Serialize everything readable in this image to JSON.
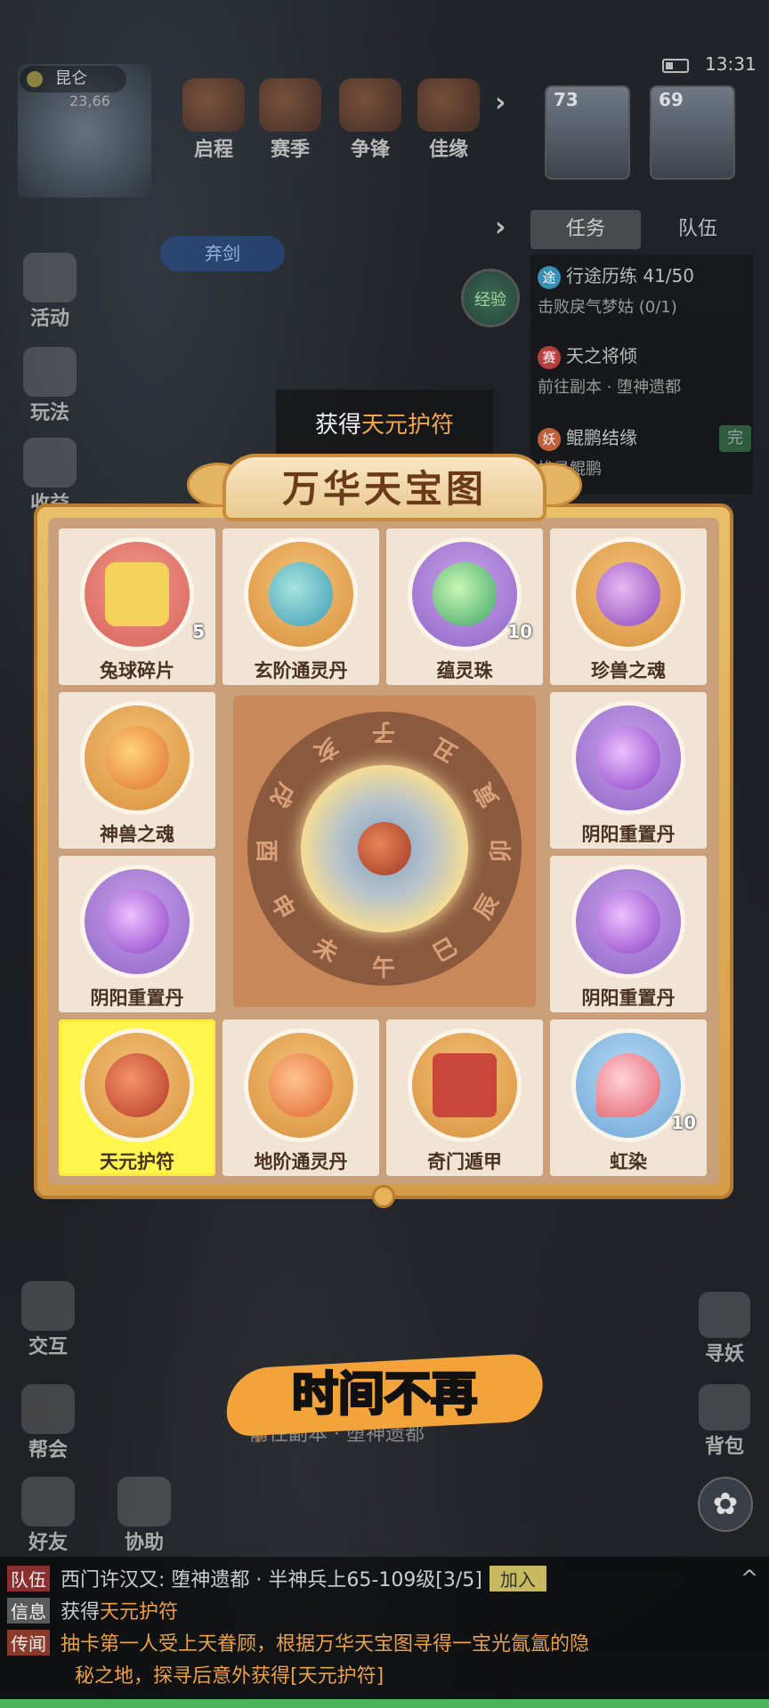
{
  "status_bar": {
    "time": "13:31"
  },
  "minimap": {
    "location": "昆仑",
    "coords": "23,66",
    "marker_label": "弃剑"
  },
  "top_nav": [
    {
      "label": "启程"
    },
    {
      "label": "赛季"
    },
    {
      "label": "争锋"
    },
    {
      "label": "佳缘"
    }
  ],
  "party": [
    {
      "level": "73"
    },
    {
      "level": "69"
    }
  ],
  "panel_tabs": {
    "task": "任务",
    "team": "队伍"
  },
  "exp_button": "经验",
  "tasks": [
    {
      "badge": "途",
      "badge_color": "#3a8fb5",
      "title": "行途历练 41/50",
      "sub": "击败戾气梦姑 (0/1)"
    },
    {
      "badge": "赛",
      "badge_color": "#b54040",
      "title": "天之将倾",
      "sub": "前往副本 · 堕神遗都"
    },
    {
      "badge": "妖",
      "badge_color": "#c0603a",
      "title": "鲲鹏结缘",
      "sub": "找寻鲲鹏",
      "status": "完"
    }
  ],
  "left_menu": [
    {
      "label": "活动"
    },
    {
      "label": "玩法"
    },
    {
      "label": "收益"
    }
  ],
  "toast": {
    "prefix": "获得",
    "item": "天元护符"
  },
  "board": {
    "title": "万华天宝图",
    "center_ring": [
      "子",
      "丑",
      "寅",
      "卯",
      "辰",
      "巳",
      "午",
      "未",
      "申",
      "酉",
      "戌",
      "亥"
    ],
    "cells": [
      {
        "name": "兔球碎片",
        "count": "5",
        "theme": "red"
      },
      {
        "name": "玄阶通灵丹",
        "count": "",
        "theme": "gold"
      },
      {
        "name": "蕴灵珠",
        "count": "10",
        "theme": "purple"
      },
      {
        "name": "珍兽之魂",
        "count": "",
        "theme": "gold"
      },
      {
        "name": "神兽之魂",
        "count": "",
        "theme": "gold"
      },
      {
        "name": "阴阳重置丹",
        "count": "",
        "theme": "purple"
      },
      {
        "name": "阴阳重置丹",
        "count": "",
        "theme": "purple"
      },
      {
        "name": "阴阳重置丹",
        "count": "",
        "theme": "purple"
      },
      {
        "name": "天元护符",
        "count": "",
        "theme": "gold",
        "selected": true
      },
      {
        "name": "地阶通灵丹",
        "count": "",
        "theme": "gold"
      },
      {
        "name": "奇门遁甲",
        "count": "",
        "theme": "gold"
      },
      {
        "name": "虹染",
        "count": "10",
        "theme": "blue"
      }
    ]
  },
  "subtitle": "时间不再",
  "subtitle_task": "前往副本 · 堕神遗都",
  "bottom_left_menu": [
    {
      "label": "交互"
    },
    {
      "label": "帮会"
    },
    {
      "label": "好友"
    },
    {
      "label": "协助"
    }
  ],
  "right_menu": [
    {
      "label": "寻妖"
    },
    {
      "label": "背包"
    }
  ],
  "chat": [
    {
      "tag": "队伍",
      "text": "西门许汉又: 堕神遗都 · 半神兵上65-109级[3/5]",
      "button": "加入"
    },
    {
      "tag": "信息",
      "prefix": "获得",
      "highlight": "天元护符"
    },
    {
      "tag": "传闻",
      "text": "抽卡第一人受上天眷顾，根据万华天宝图寻得一宝光氤氲的隐",
      "text2": "秘之地，探寻后意外获得[天元护符]"
    }
  ]
}
